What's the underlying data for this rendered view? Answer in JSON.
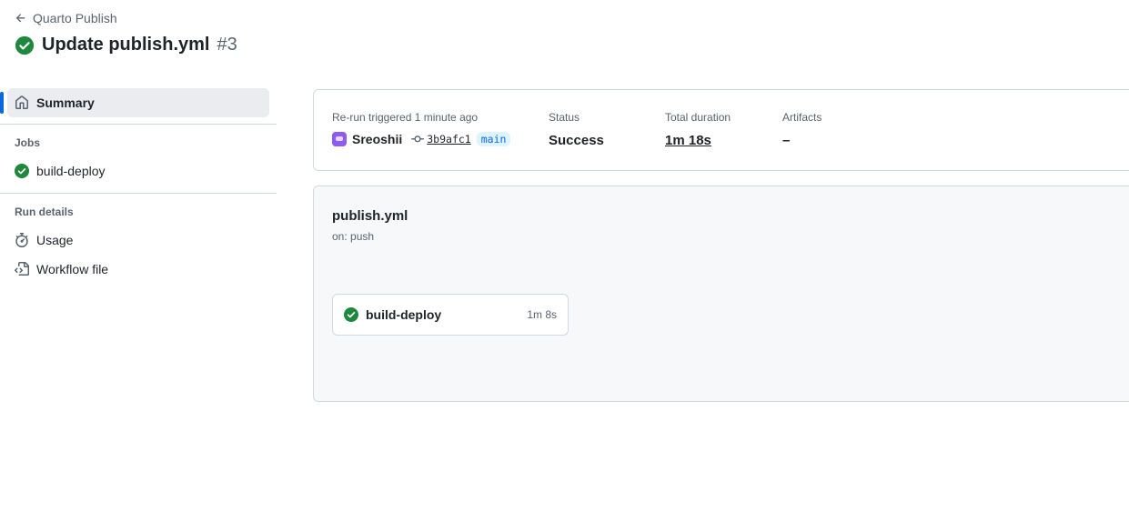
{
  "header": {
    "back_label": "Quarto Publish",
    "title": "Update publish.yml",
    "run_number": "#3"
  },
  "sidebar": {
    "summary_label": "Summary",
    "jobs_heading": "Jobs",
    "jobs": [
      {
        "label": "build-deploy"
      }
    ],
    "run_details_heading": "Run details",
    "run_details": [
      {
        "label": "Usage"
      },
      {
        "label": "Workflow file"
      }
    ]
  },
  "summary": {
    "trigger_label": "Re-run triggered 1 minute ago",
    "actor": "Sreoshii",
    "commit": "3b9afc1",
    "branch": "main",
    "status_label": "Status",
    "status_value": "Success",
    "duration_label": "Total duration",
    "duration_value": "1m 18s",
    "artifacts_label": "Artifacts",
    "artifacts_value": "–"
  },
  "workflow": {
    "name": "publish.yml",
    "trigger": "on: push",
    "job": {
      "name": "build-deploy",
      "time": "1m 8s"
    }
  },
  "colors": {
    "success": "#1f883d",
    "accent": "#0969da"
  }
}
